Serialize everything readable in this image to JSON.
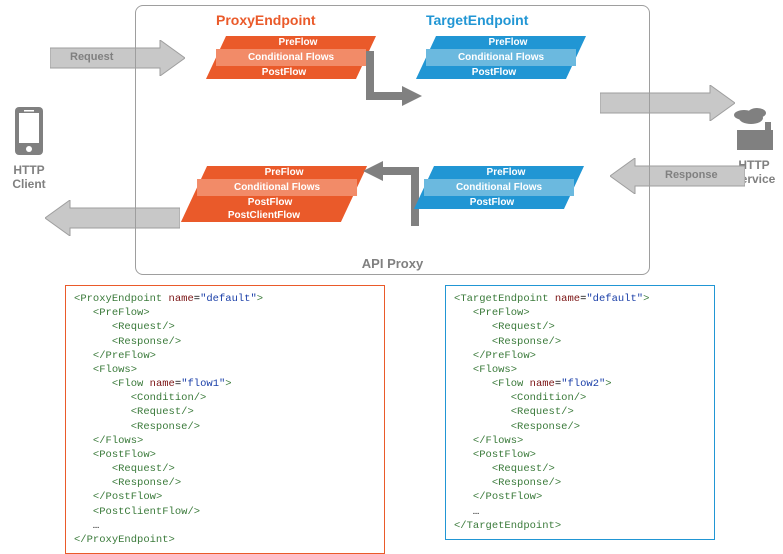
{
  "client": {
    "label_l1": "HTTP",
    "label_l2": "Client"
  },
  "service": {
    "label_l1": "HTTP",
    "label_l2": "Service"
  },
  "labels": {
    "request": "Request",
    "response": "Response"
  },
  "box": {
    "proxy_endpoint": "ProxyEndpoint",
    "target_endpoint": "TargetEndpoint",
    "footer": "API Proxy"
  },
  "blocks": {
    "preflow": "PreFlow",
    "conditional": "Conditional Flows",
    "postflow": "PostFlow",
    "postclient": "PostClientFlow"
  },
  "code_proxy": {
    "endpoint_open_tag": "ProxyEndpoint",
    "endpoint_name_attr": "name",
    "endpoint_name_val": "\"default\"",
    "preflow": "PreFlow",
    "request": "Request",
    "response": "Response",
    "flows": "Flows",
    "flow": "Flow",
    "flow_name_attr": "name",
    "flow_name_val": "\"flow1\"",
    "condition": "Condition",
    "postflow": "PostFlow",
    "postclient": "PostClientFlow",
    "ellipsis": "…"
  },
  "code_target": {
    "endpoint_open_tag": "TargetEndpoint",
    "endpoint_name_attr": "name",
    "endpoint_name_val": "\"default\"",
    "preflow": "PreFlow",
    "request": "Request",
    "response": "Response",
    "flows": "Flows",
    "flow": "Flow",
    "flow_name_attr": "name",
    "flow_name_val": "\"flow2\"",
    "condition": "Condition",
    "postflow": "PostFlow",
    "ellipsis": "…"
  }
}
